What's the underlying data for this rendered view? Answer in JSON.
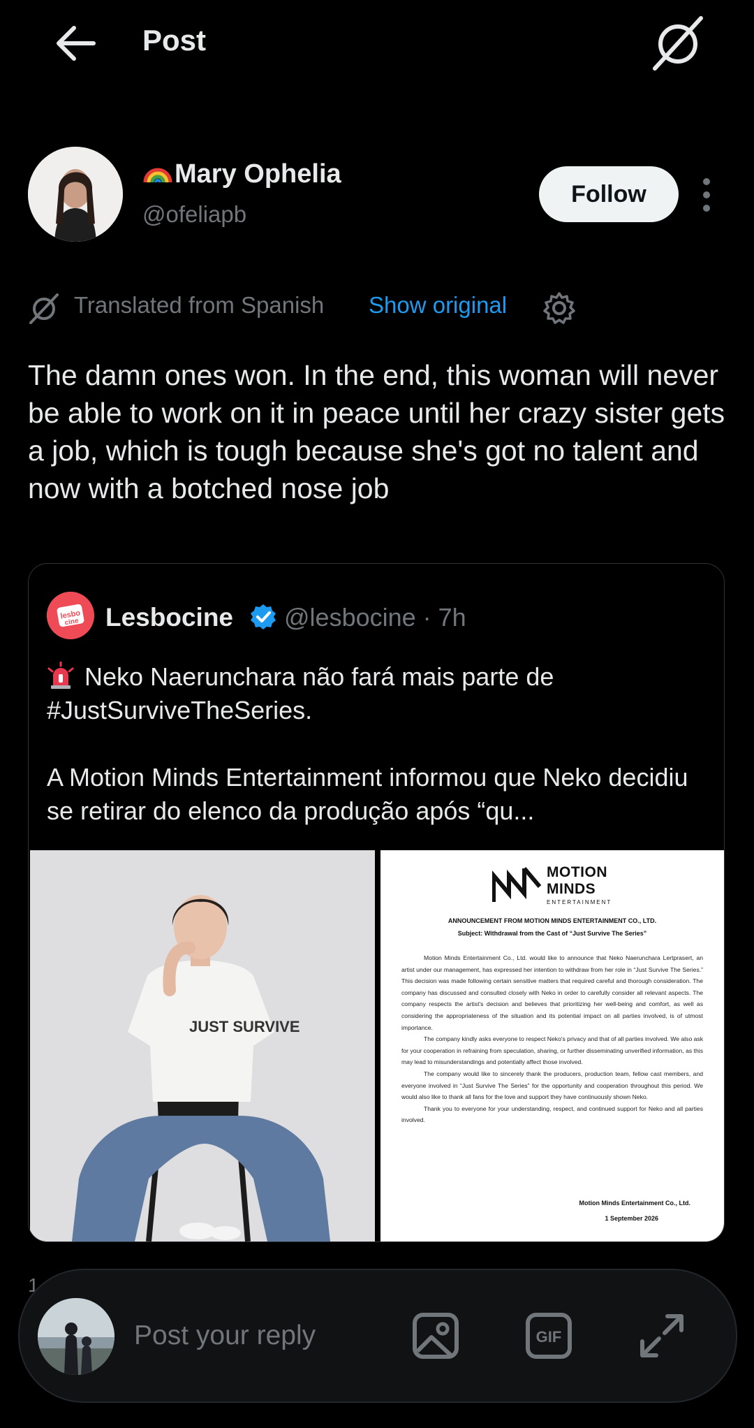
{
  "header": {
    "title": "Post"
  },
  "author": {
    "display_name": "Mary Ophelia",
    "handle": "@ofeliapb",
    "follow_label": "Follow"
  },
  "translation": {
    "label": "Translated from Spanish",
    "show_original": "Show original"
  },
  "post": {
    "text": "The damn ones won. In the end, this woman will never be able to work on it in peace until her crazy sister gets a job, which is tough because she's got no talent and now with a botched nose job"
  },
  "quote": {
    "avatar_text": "lesbo cine",
    "display_name": "Lesbocine",
    "handle_time": "@lesbocine · 7h",
    "text": "Neko Naerunchara não fará mais parte de #JustSurviveTheSeries.\n\nA Motion Minds Entertainment informou que Neko decidiu se retirar do elenco da produção após “qu...",
    "shirt_text": "JUST SURVIVE",
    "document": {
      "logo_line1": "MOTION",
      "logo_line2": "MINDS",
      "logo_line3": "ENTERTAINMENT",
      "heading": "ANNOUNCEMENT FROM MOTION MINDS ENTERTAINMENT CO., LTD.",
      "subject": "Subject: Withdrawal from the Cast of “Just Survive The Series”",
      "p1": "Motion Minds Entertainment Co., Ltd. would like to announce that Neko Naerunchara Lertprasert, an artist under our management, has expressed her intention to withdraw from her role in “Just Survive The Series.” This decision was made following certain sensitive matters that required careful and thorough consideration. The company has discussed and consulted closely with Neko in order to carefully consider all relevant aspects. The company respects the artist's decision and believes that prioritizing her well-being and comfort, as well as considering the appropriateness of the situation and its potential impact on all parties involved, is of utmost importance.",
      "p2": "The company kindly asks everyone to respect Neko's privacy and that of all parties involved. We also ask for your cooperation in refraining from speculation, sharing, or further disseminating unverified information, as this may lead to misunderstandings and potentially affect those involved.",
      "p3": "The company would like to sincerely thank the producers, production team, fellow cast members, and everyone involved in “Just Survive The Series” for the opportunity and cooperation throughout this period. We would also like to thank all fans for the love and support they have continuously shown Neko.",
      "p4": "Thank you to everyone for your understanding, respect, and continued support for Neko and all parties involved.",
      "signature": "Motion Minds Entertainment Co., Ltd.",
      "date": "1 September 2026"
    }
  },
  "reply_count": "1",
  "reply": {
    "placeholder": "Post your reply",
    "gif_label": "GIF"
  },
  "colors": {
    "background": "#000000",
    "accent": "#1d9bf0",
    "muted": "#71767b",
    "text": "#e7e9ea"
  },
  "icons": [
    "back-arrow-icon",
    "grok-icon",
    "more-icon",
    "translate-icon",
    "gear-icon",
    "rainbow-icon",
    "verified-icon",
    "siren-icon",
    "image-icon",
    "gif-icon",
    "expand-icon"
  ]
}
